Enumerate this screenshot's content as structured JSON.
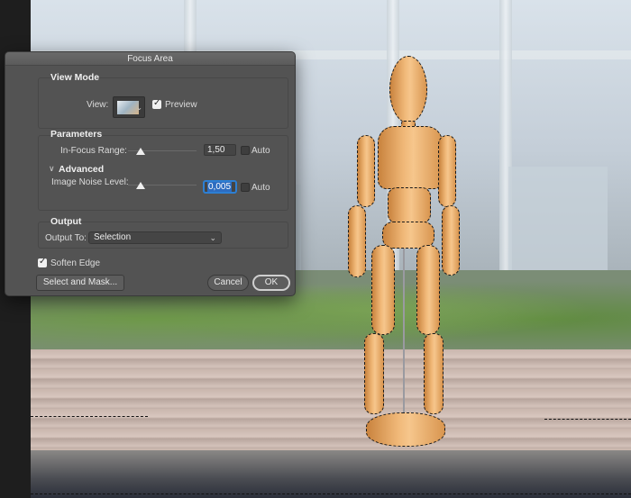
{
  "dialog": {
    "title": "Focus Area",
    "view_mode": {
      "title": "View Mode",
      "view_label": "View:",
      "preview_label": "Preview",
      "preview_checked": true
    },
    "parameters": {
      "title": "Parameters",
      "in_focus_range_label": "In-Focus Range:",
      "in_focus_range_value": "1,50",
      "in_focus_auto_label": "Auto",
      "in_focus_auto_checked": false,
      "in_focus_slider_fraction": 0.19,
      "advanced_label": "Advanced",
      "image_noise_label": "Image Noise Level:",
      "image_noise_value": "0,005",
      "image_noise_auto_label": "Auto",
      "image_noise_auto_checked": false,
      "image_noise_slider_fraction": 0.19
    },
    "output": {
      "title": "Output",
      "output_to_label": "Output To:",
      "output_to_value": "Selection"
    },
    "soften_edge_label": "Soften Edge",
    "soften_edge_checked": true,
    "select_and_mask_label": "Select and Mask...",
    "cancel_label": "Cancel",
    "ok_label": "OK"
  },
  "tools": [
    {
      "name": "zoom-tool",
      "icon": "magnifier-icon",
      "glyph": "🔍︎"
    },
    {
      "name": "hand-tool",
      "icon": "hand-icon",
      "glyph": "✋︎"
    },
    {
      "name": "focus-area-add-tool",
      "icon": "brush-plus-icon",
      "glyph": "✎"
    },
    {
      "name": "focus-area-subtract-tool",
      "icon": "brush-minus-icon",
      "glyph": "✎"
    }
  ],
  "colors": {
    "dialog_bg": "#535353",
    "focus_blue": "#2d7fd3"
  }
}
